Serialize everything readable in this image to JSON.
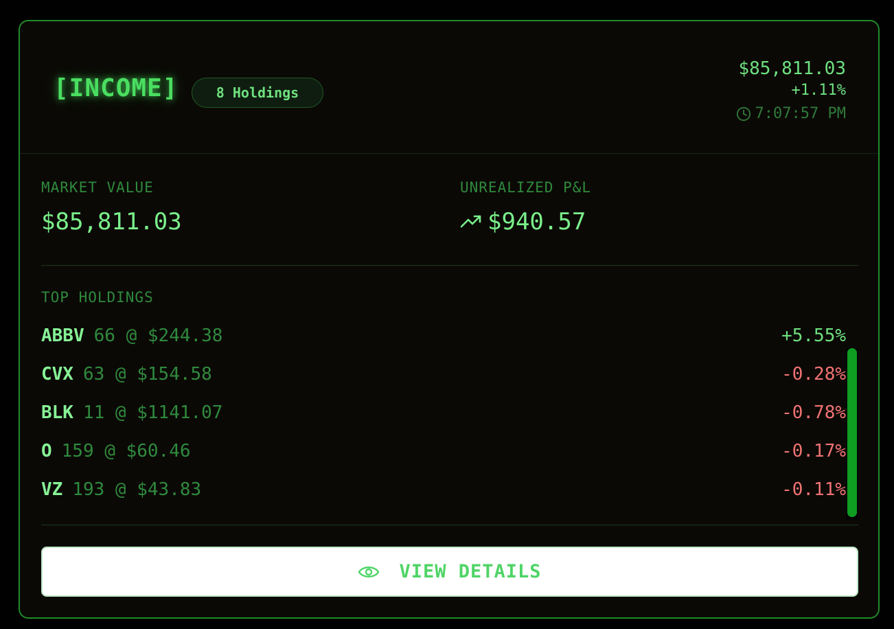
{
  "header": {
    "title": "[INCOME]",
    "holdings_badge": "8 Holdings",
    "total_value": "$85,811.03",
    "change_pct": "+1.11%",
    "timestamp": "7:07:57 PM",
    "timestamp_icon": "clock-icon"
  },
  "metrics": {
    "market_value_label": "MARKET VALUE",
    "market_value": "$85,811.03",
    "unrealized_label": "UNREALIZED P&L",
    "unrealized_value": "$940.57",
    "unrealized_icon": "trending-up-icon"
  },
  "holdings": {
    "label": "TOP HOLDINGS",
    "rows": [
      {
        "ticker": "ABBV",
        "position": "66 @ $244.38",
        "change": "+5.55%",
        "direction": "up"
      },
      {
        "ticker": "CVX",
        "position": "63 @ $154.58",
        "change": "-0.28%",
        "direction": "down"
      },
      {
        "ticker": "BLK",
        "position": "11 @ $1141.07",
        "change": "-0.78%",
        "direction": "down"
      },
      {
        "ticker": "O",
        "position": "159 @ $60.46",
        "change": "-0.17%",
        "direction": "down"
      },
      {
        "ticker": "VZ",
        "position": "193 @ $43.83",
        "change": "-0.11%",
        "direction": "down"
      }
    ]
  },
  "actions": {
    "view_details_label": "VIEW DETAILS",
    "view_details_icon": "eye-icon"
  },
  "colors": {
    "accent": "#4ade60",
    "positive": "#6ee07f",
    "negative": "#f07373",
    "border": "#1f8a2a",
    "background": "#0b0906"
  }
}
